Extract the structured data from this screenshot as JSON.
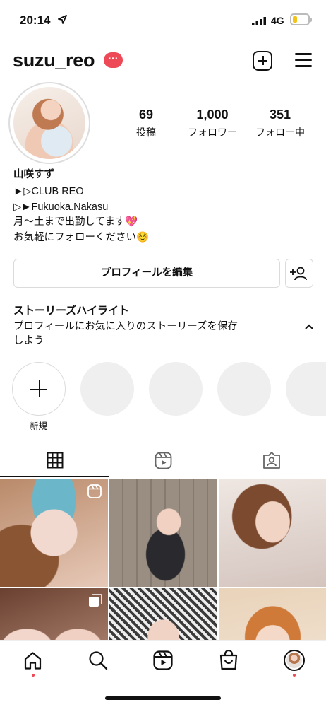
{
  "status_bar": {
    "time": "20:14",
    "network": "4G",
    "battery_level": 0.3
  },
  "profile": {
    "username": "suzu_reo",
    "badge": "···",
    "stats": [
      {
        "value": "69",
        "label": "投稿"
      },
      {
        "value": "1,000",
        "label": "フォロワー"
      },
      {
        "value": "351",
        "label": "フォロー中"
      }
    ],
    "bio": {
      "name": "山咲すず",
      "lines": [
        "►▷CLUB REO",
        "▷►Fukuoka.Nakasu",
        "月〜土まで出勤してます💖",
        "お気軽にフォローください☺️"
      ]
    },
    "edit_label": "プロフィールを編集"
  },
  "highlights": {
    "title": "ストーリーズハイライト",
    "description": "プロフィールにお気に入りのストーリーズを保存しよう",
    "new_label": "新規"
  },
  "colors": {
    "accent": "#ed4956",
    "border": "#dbdbdb",
    "placeholder": "#efefef"
  },
  "icons": {
    "header": [
      "add-square-icon",
      "hamburger-menu-icon"
    ],
    "tabs": [
      "grid-icon",
      "reels-icon",
      "tagged-icon"
    ],
    "nav": [
      "home-icon",
      "search-icon",
      "reels-icon",
      "shop-icon",
      "profile-avatar"
    ]
  }
}
